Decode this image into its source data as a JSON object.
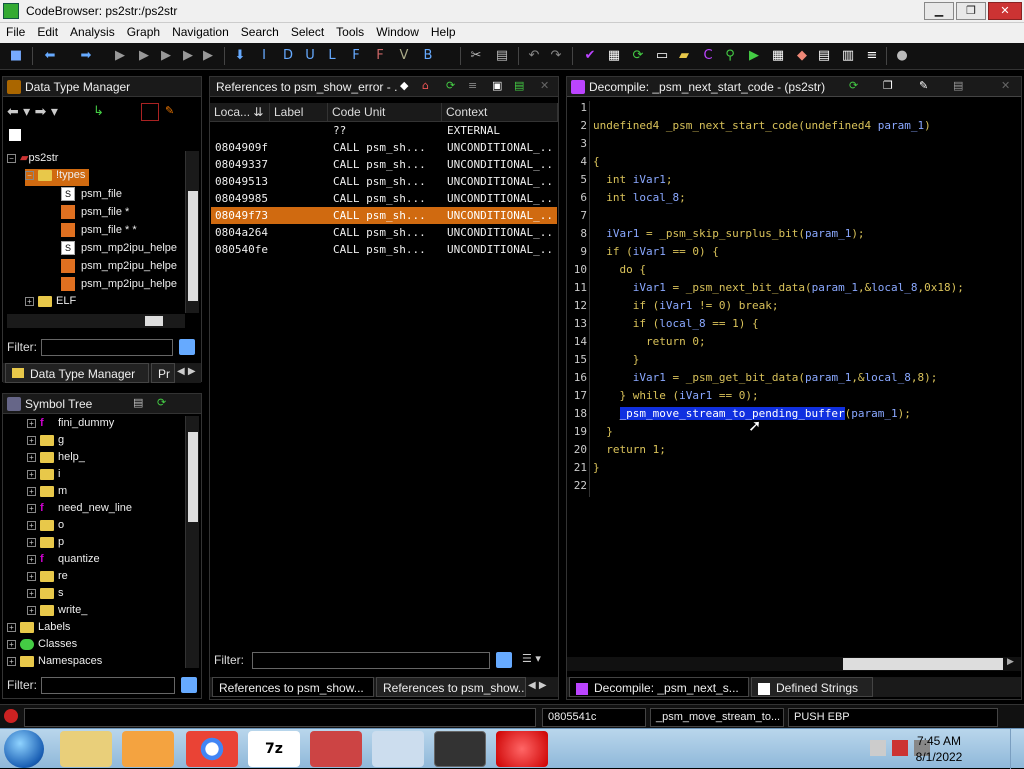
{
  "window": {
    "title": "CodeBrowser: ps2str:/ps2str"
  },
  "menu": [
    "File",
    "Edit",
    "Analysis",
    "Graph",
    "Navigation",
    "Search",
    "Select",
    "Tools",
    "Window",
    "Help"
  ],
  "data_type_manager": {
    "title": "Data Type Manager",
    "tree": {
      "root": "ps2str",
      "types_folder": "!types",
      "items": [
        "psm_file",
        "psm_file *",
        "psm_file * *",
        "psm_mp2ipu_helpe",
        "psm_mp2ipu_helpe",
        "psm_mp2ipu_helpe"
      ],
      "elf": "ELF"
    },
    "filter_label": "Filter:",
    "tabs": [
      "Data Type Manager",
      "Pr"
    ]
  },
  "symbol_tree": {
    "title": "Symbol Tree",
    "items": [
      {
        "label": "fini_dummy",
        "kind": "func"
      },
      {
        "label": "g",
        "kind": "folder"
      },
      {
        "label": "help_",
        "kind": "folder"
      },
      {
        "label": "i",
        "kind": "folder"
      },
      {
        "label": "m",
        "kind": "folder"
      },
      {
        "label": "need_new_line",
        "kind": "func"
      },
      {
        "label": "o",
        "kind": "folder"
      },
      {
        "label": "p",
        "kind": "folder"
      },
      {
        "label": "quantize",
        "kind": "func"
      },
      {
        "label": "re",
        "kind": "folder"
      },
      {
        "label": "s",
        "kind": "folder"
      },
      {
        "label": "write_",
        "kind": "folder"
      }
    ],
    "top_items": [
      "Labels",
      "Classes",
      "Namespaces"
    ],
    "filter_label": "Filter:"
  },
  "references": {
    "title": "References to psm_show_error - ...",
    "columns": [
      "Loca...",
      "Label",
      "Code Unit",
      "Context"
    ],
    "rows": [
      {
        "loc": "",
        "label": "",
        "code": "??",
        "ctx": "EXTERNAL",
        "selected": false
      },
      {
        "loc": "0804909f",
        "label": "",
        "code": "CALL psm_sh...",
        "ctx": "UNCONDITIONAL_...",
        "selected": false
      },
      {
        "loc": "08049337",
        "label": "",
        "code": "CALL psm_sh...",
        "ctx": "UNCONDITIONAL_...",
        "selected": false
      },
      {
        "loc": "08049513",
        "label": "",
        "code": "CALL psm_sh...",
        "ctx": "UNCONDITIONAL_...",
        "selected": false
      },
      {
        "loc": "08049985",
        "label": "",
        "code": "CALL psm_sh...",
        "ctx": "UNCONDITIONAL_...",
        "selected": false
      },
      {
        "loc": "08049f73",
        "label": "",
        "code": "CALL psm_sh...",
        "ctx": "UNCONDITIONAL_...",
        "selected": true
      },
      {
        "loc": "0804a264",
        "label": "",
        "code": "CALL psm_sh...",
        "ctx": "UNCONDITIONAL_...",
        "selected": false
      },
      {
        "loc": "080540fe",
        "label": "",
        "code": "CALL psm_sh...",
        "ctx": "UNCONDITIONAL_...",
        "selected": false
      }
    ],
    "filter_label": "Filter:",
    "tabs": [
      "References to psm_show...",
      "References to psm_show..."
    ]
  },
  "decompile": {
    "title": "Decompile: _psm_next_start_code -  (ps2str)",
    "lines": [
      "",
      "undefined4 _psm_next_start_code(undefined4 param_1)",
      "",
      "{",
      "  int iVar1;",
      "  int local_8;",
      "",
      "  iVar1 = _psm_skip_surplus_bit(param_1);",
      "  if (iVar1 == 0) {",
      "    do {",
      "      iVar1 = _psm_next_bit_data(param_1,&local_8,0x18);",
      "      if (iVar1 != 0) break;",
      "      if (local_8 == 1) {",
      "        return 0;",
      "      }",
      "      iVar1 = _psm_get_bit_data(param_1,&local_8,8);",
      "    } while (iVar1 == 0);",
      "    _psm_move_stream_to_pending_buffer(param_1);",
      "  }",
      "  return 1;",
      "}",
      ""
    ],
    "highlight_line": 18,
    "highlight_text": "_psm_move_stream_to_pending_buffer",
    "tabs": [
      "Decompile: _psm_next_s...",
      "Defined Strings"
    ]
  },
  "status": {
    "address": "0805541c",
    "function": "_psm_move_stream_to...",
    "instruction": "PUSH EBP"
  },
  "taskbar": {
    "time": "7:45 AM",
    "date": "8/1/2022"
  }
}
